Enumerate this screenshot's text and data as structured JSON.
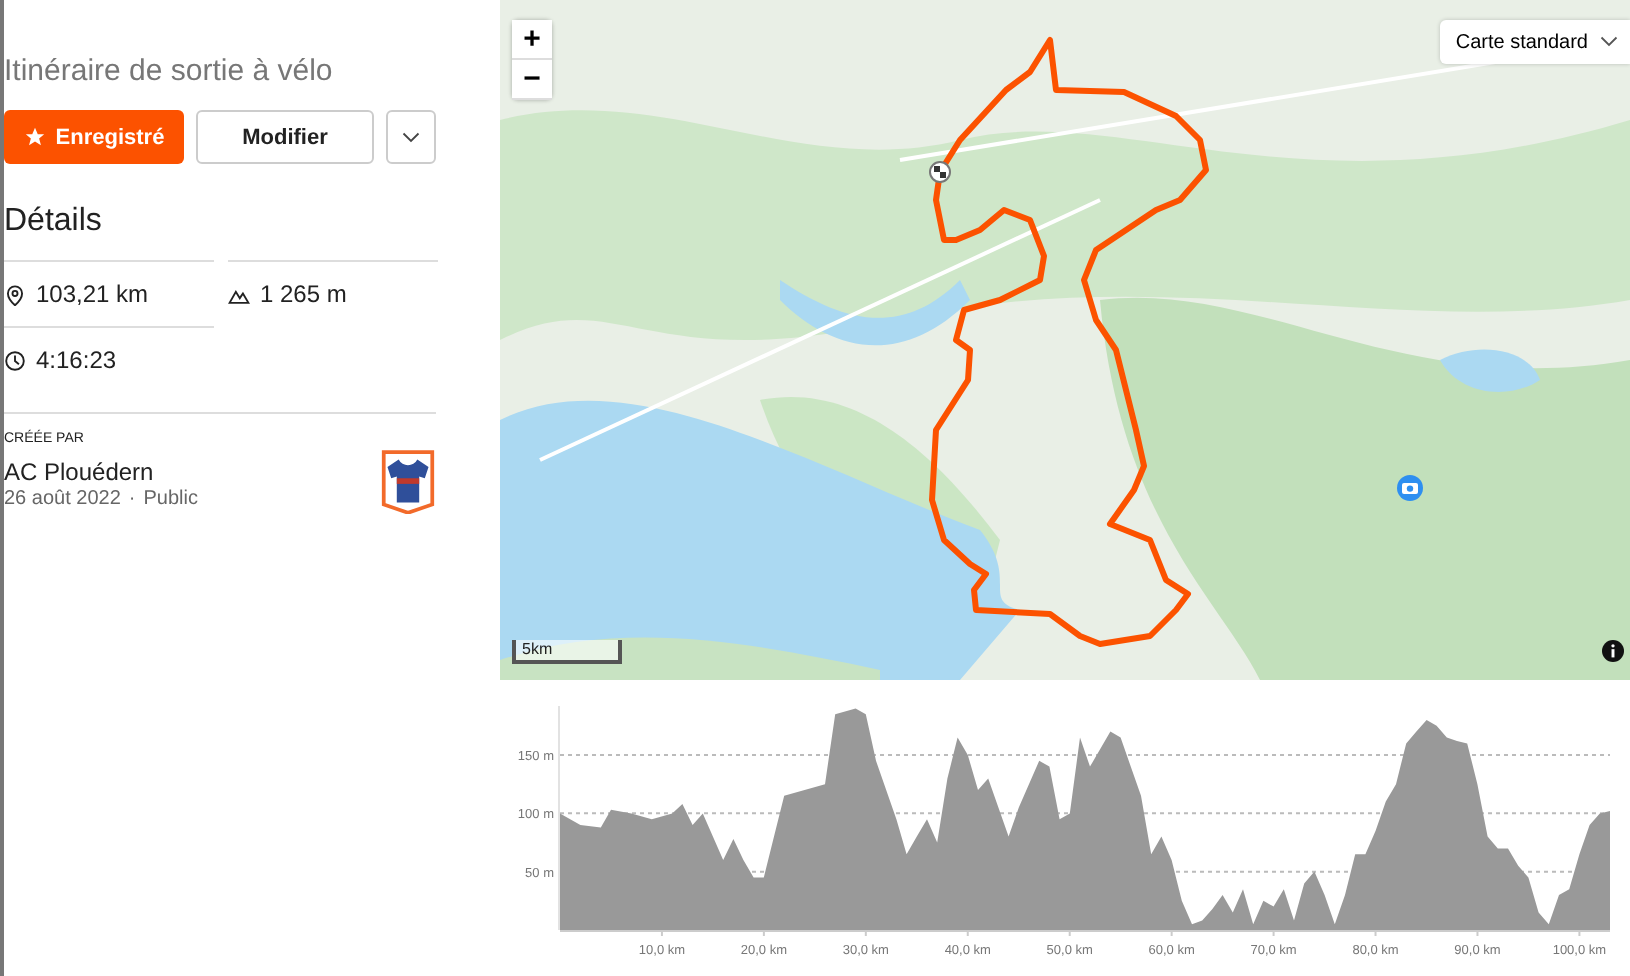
{
  "route": {
    "title": "Itinéraire de sortie à vélo",
    "buttons": [
      {
        "label": "Enregistré",
        "kind": "primary"
      },
      {
        "label": "Modifier",
        "kind": "secondary"
      }
    ],
    "details": {
      "heading": "Détails",
      "stats": [
        {
          "kind": "distance",
          "value": "103,21 km"
        },
        {
          "kind": "elevation",
          "value": "1 265 m"
        },
        {
          "kind": "time",
          "value": "4:16:23"
        }
      ]
    },
    "creator": {
      "label": "CRÉÉE PAR",
      "name": "AC Plouédern",
      "date": "26 août 2022",
      "separator": "·",
      "visibility": "Public"
    }
  },
  "map": {
    "zoom_buttons": [
      "+",
      "−"
    ],
    "style_selector": "Carte standard",
    "scale": "5km"
  },
  "elevation_profile": {
    "chart_data": {
      "type": "area",
      "xlim": [
        0,
        103
      ],
      "ylim": [
        0,
        192
      ],
      "grid": true,
      "xticks": [
        {
          "value": 10,
          "label": "10,0 km"
        },
        {
          "value": 20,
          "label": "20,0 km"
        },
        {
          "value": 30,
          "label": "30,0 km"
        },
        {
          "value": 40,
          "label": "40,0 km"
        },
        {
          "value": 50,
          "label": "50,0 km"
        },
        {
          "value": 60,
          "label": "60,0 km"
        },
        {
          "value": 70,
          "label": "70,0 km"
        },
        {
          "value": 80,
          "label": "80,0 km"
        },
        {
          "value": 90,
          "label": "90,0 km"
        },
        {
          "value": 100,
          "label": "100,0 km"
        }
      ],
      "yticks": [
        {
          "value": 50,
          "label": "50 m"
        },
        {
          "value": 100,
          "label": "100 m"
        },
        {
          "value": 150,
          "label": "150 m"
        }
      ],
      "x": [
        0,
        2,
        4,
        5,
        7,
        9,
        11,
        12,
        13,
        14,
        16,
        17,
        18,
        19,
        20,
        21,
        22,
        24,
        26,
        27,
        29,
        30,
        31,
        33,
        34,
        35,
        36,
        37,
        38,
        39,
        40,
        41,
        42,
        43,
        44,
        45,
        47,
        48,
        49,
        50,
        51,
        52,
        54,
        55,
        57,
        58,
        59,
        60,
        61,
        62,
        63,
        64,
        65,
        66,
        67,
        68,
        69,
        70,
        71,
        72,
        73,
        74,
        75,
        76,
        77,
        78,
        79,
        80,
        81,
        82,
        83,
        84,
        85,
        86,
        87,
        88,
        89,
        90,
        91,
        92,
        93,
        94,
        95,
        96,
        97,
        98,
        99,
        100,
        101,
        102,
        103
      ],
      "series": [
        {
          "color": "#999999",
          "values": [
            100,
            90,
            88,
            103,
            100,
            95,
            100,
            108,
            90,
            100,
            60,
            78,
            60,
            45,
            45,
            80,
            115,
            120,
            125,
            185,
            190,
            185,
            145,
            95,
            65,
            80,
            95,
            75,
            130,
            165,
            150,
            120,
            130,
            105,
            80,
            105,
            145,
            140,
            95,
            100,
            165,
            140,
            170,
            165,
            115,
            65,
            80,
            60,
            25,
            5,
            8,
            18,
            30,
            15,
            35,
            5,
            25,
            20,
            35,
            8,
            40,
            50,
            30,
            5,
            30,
            65,
            65,
            85,
            110,
            125,
            160,
            170,
            180,
            175,
            165,
            162,
            160,
            125,
            80,
            70,
            70,
            55,
            45,
            15,
            5,
            30,
            35,
            65,
            90,
            100,
            102
          ]
        }
      ]
    }
  }
}
